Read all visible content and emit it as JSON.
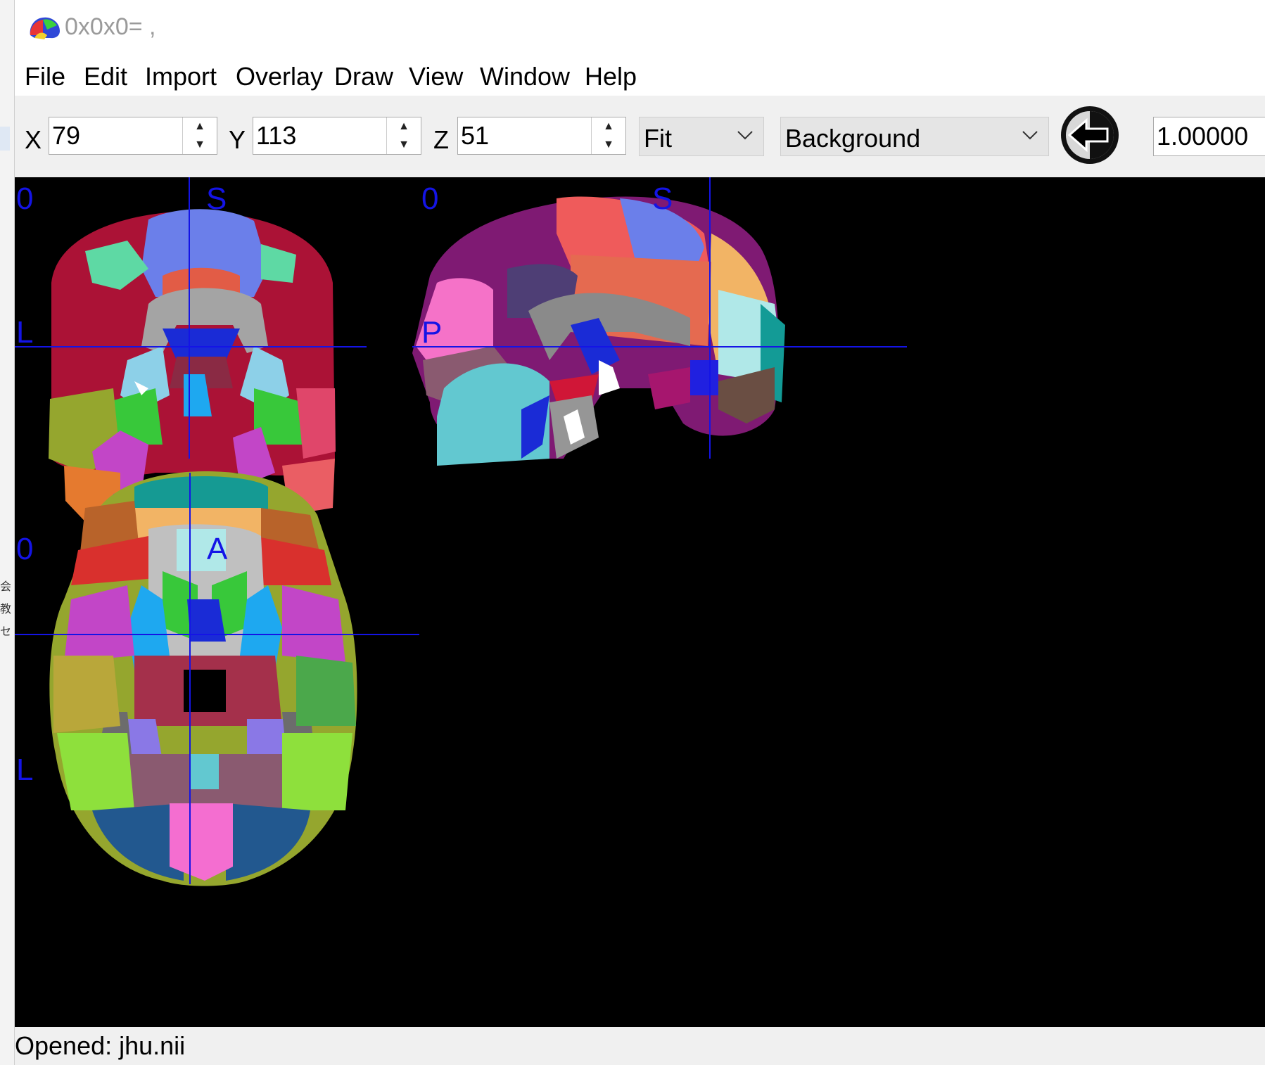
{
  "window": {
    "title": "0x0x0= ,"
  },
  "left_fragments": [
    "会",
    "教",
    "セ"
  ],
  "menu": [
    "File",
    "Edit",
    "Import",
    "Overlay",
    "Draw",
    "View",
    "Window",
    "Help"
  ],
  "toolbar": {
    "x_label": "X",
    "x_value": "79",
    "y_label": "Y",
    "y_value": "113",
    "z_label": "Z",
    "z_value": "51",
    "zoom_mode": "Fit",
    "colormap": "Background",
    "opacity": "1.00000"
  },
  "views": {
    "coronal": {
      "corner": "0",
      "top": "S",
      "side": "L"
    },
    "sagittal": {
      "corner": "0",
      "top": "S",
      "side": "P"
    },
    "axial": {
      "corner": "0",
      "top": "A",
      "side": "L"
    }
  },
  "status": "Opened: jhu.nii",
  "icons": {
    "app": "brain-icon",
    "direction": "back-arrow-icon",
    "dropdown": "chevron-down-icon"
  },
  "colors": {
    "crosshair": "#1414e6",
    "viewer_bg": "#000000"
  }
}
